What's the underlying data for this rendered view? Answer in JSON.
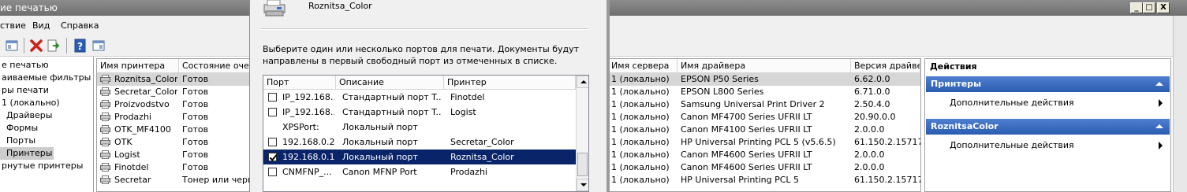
{
  "window": {
    "title": "ие печатью",
    "min": "_",
    "max": "□",
    "close": "X"
  },
  "menu": [
    "ствие",
    "Вид",
    "Справка"
  ],
  "tree": [
    {
      "label": "е печатью"
    },
    {
      "label": "аиваемые фильтры"
    },
    {
      "label": "ры печати"
    },
    {
      "label": "1 (локально)"
    },
    {
      "label": "Драйверы"
    },
    {
      "label": "Формы"
    },
    {
      "label": "Порты"
    },
    {
      "label": "Принтеры"
    },
    {
      "label": "рнутые принтеры"
    }
  ],
  "list": {
    "headers": [
      "Имя принтера",
      "Состояние оче",
      "",
      "Имя сервера",
      "Имя драйвера",
      "Версия драйвер"
    ],
    "rows": [
      {
        "name": "Roznitsa_Color",
        "status": "Готов",
        "server": "1 (локально)",
        "driver": "EPSON P50 Series",
        "version": "6.62.0.0"
      },
      {
        "name": "Secretar_Color",
        "status": "Готов",
        "server": "1 (локально)",
        "driver": "EPSON L800 Series",
        "version": "6.71.0.0"
      },
      {
        "name": "Proizvodstvo",
        "status": "Готов",
        "server": "1 (локально)",
        "driver": "Samsung Universal Print Driver 2",
        "version": "2.50.4.0"
      },
      {
        "name": "Prodazhi",
        "status": "Готов",
        "server": "1 (локально)",
        "driver": "Canon MF4700 Series UFRII LT",
        "version": "20.90.0.0"
      },
      {
        "name": "OTK_MF4100",
        "status": "Готов",
        "server": "1 (локально)",
        "driver": "Canon MF4100 Series UFRII LT",
        "version": "2.0.0.0"
      },
      {
        "name": "OTK",
        "status": "Готов",
        "server": "1 (локально)",
        "driver": "HP Universal Printing PCL 5 (v5.6.5)",
        "version": "61.150.2.15717"
      },
      {
        "name": "Logist",
        "status": "Готов",
        "server": "1 (локально)",
        "driver": "Canon MF4600 Series UFRII LT",
        "version": "2.0.0.0"
      },
      {
        "name": "Finotdel",
        "status": "Готов",
        "server": "1 (локально)",
        "driver": "Canon MF4600 Series UFRII LT",
        "version": "2.0.0.0"
      },
      {
        "name": "Secretar",
        "status": "Тонер или черн",
        "server": "1 (локально)",
        "driver": "HP Universal Printing PCL 5",
        "version": "61.150.2.15717"
      }
    ]
  },
  "actions": {
    "header": "Действия",
    "sections": [
      {
        "title": "Принтеры",
        "item": "Дополнительные действия"
      },
      {
        "title": "RoznitsaColor",
        "item": "Дополнительные действия"
      }
    ]
  },
  "dialog": {
    "printer_name": "Roznitsa_Color",
    "desc_line1": "Выберите один или несколько портов для печати. Документы будут",
    "desc_line2": "направлены в первый свободный порт из отмеченных в списке.",
    "headers": [
      "Порт",
      "Описание",
      "Принтер"
    ],
    "ports": [
      {
        "port": "IP_192.168....",
        "desc": "Стандартный порт T...",
        "printer": "Finotdel",
        "checked": false
      },
      {
        "port": "IP_192.168....",
        "desc": "Стандартный порт T...",
        "printer": "Logist",
        "checked": false
      },
      {
        "port": "XPSPort:",
        "desc": "Локальный порт",
        "printer": "",
        "checked": false
      },
      {
        "port": "192.168.0.20",
        "desc": "Локальный порт",
        "printer": "Secretar_Color",
        "checked": false
      },
      {
        "port": "192.168.0.1...",
        "desc": "Локальный порт",
        "printer": "Roznitsa_Color",
        "checked": true
      },
      {
        "port": "CNMFNP_...",
        "desc": "Canon MFNP Port",
        "printer": "Prodazhi",
        "checked": false
      }
    ]
  }
}
